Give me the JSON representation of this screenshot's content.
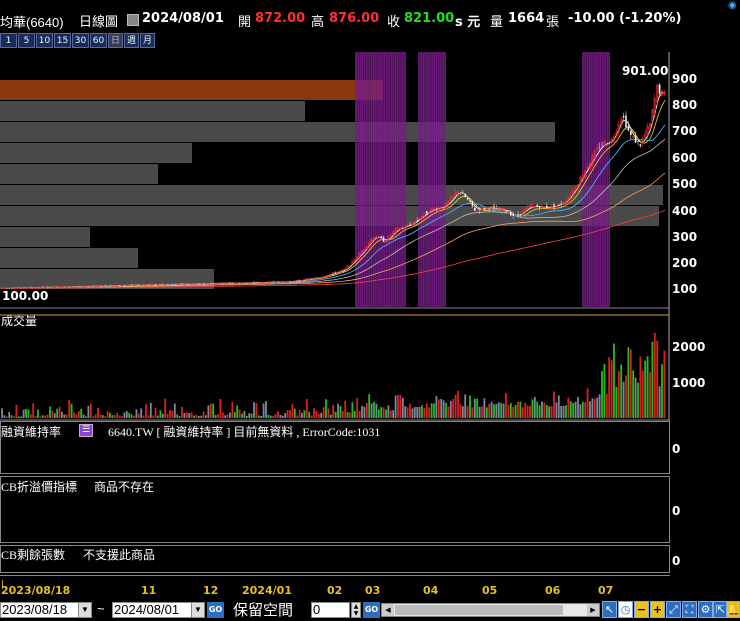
{
  "header": {
    "stock_name": "均華(6640)",
    "chart_type": "日線圖",
    "date": "2024/08/01",
    "open_label": "開",
    "open_value": "872.00",
    "high_label": "高",
    "high_value": "876.00",
    "close_label": "收",
    "close_value": "821.00",
    "unit": "s 元",
    "volume_label": "量",
    "volume_value": "1664",
    "volume_unit": "張",
    "change": "-10.00 (-1.20%)"
  },
  "timeframes": [
    "1",
    "5",
    "10",
    "15",
    "30",
    "60",
    "日",
    "週",
    "月"
  ],
  "price_panel": {
    "y_ticks": [
      "900",
      "800",
      "700",
      "600",
      "500",
      "400",
      "300",
      "200",
      "100"
    ],
    "high_marker": "901.00",
    "low_marker": "100.00"
  },
  "volume_panel": {
    "title": "成交量",
    "y_ticks": [
      "2000",
      "1000"
    ]
  },
  "margin_panel": {
    "title": "融資維持率",
    "message": "6640.TW [ 融資維持率 ] 目前無資料 , ErrorCode:1031",
    "y_tick": "0"
  },
  "cb_premium_panel": {
    "title": "CB折溢價指標",
    "message": "商品不存在",
    "y_tick": "0"
  },
  "cb_remaining_panel": {
    "title": "CB剩餘張數",
    "message": "不支援此商品",
    "y_tick": "0"
  },
  "x_axis": [
    "2023/08/18",
    "11",
    "12",
    "2024/01",
    "02",
    "03",
    "04",
    "05",
    "06",
    "07"
  ],
  "bottom": {
    "start_date": "2023/08/18",
    "separator": "~",
    "end_date": "2024/08/01",
    "go_label": "GO",
    "reserve_label": "保留空間",
    "reserve_value": "0"
  },
  "colors": {
    "up": "#ff2020",
    "down": "#20d020",
    "highlight_band": "#7a1a8a",
    "volume_profile": "#555555",
    "volume_profile_top": "#a0400a"
  },
  "chart_data": {
    "type": "candlestick",
    "price_ylim": [
      50,
      950
    ],
    "volume_ylim": [
      0,
      3000
    ],
    "start": "2023/08/18",
    "end": "2024/08/01",
    "high": 901.0,
    "low": 100.0,
    "last_close": 821.0
  }
}
